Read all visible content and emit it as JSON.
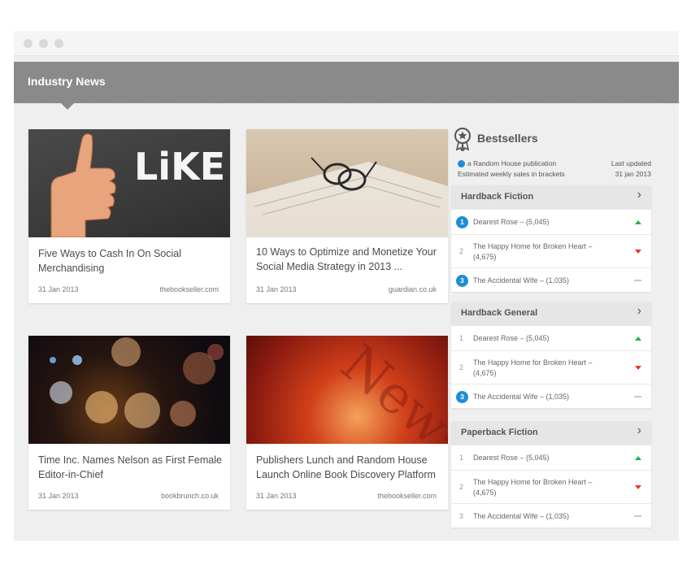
{
  "header": {
    "title": "Industry News"
  },
  "articles": [
    {
      "title": "Five Ways to Cash In On Social Merchandising",
      "date": "31 Jan 2013",
      "source": "thebookseller.com",
      "image_text": "LiKE THIS."
    },
    {
      "title": "10 Ways to Optimize and Monetize Your Social Media Strategy in 2013 ...",
      "date": "31 Jan 2013",
      "source": "guardian.co.uk"
    },
    {
      "title": "Time Inc. Names Nelson as First Female Editor-in-Chief",
      "date": "31 Jan 2013",
      "source": "bookbrunch.co.uk"
    },
    {
      "title": "Publishers Lunch and Random House Launch Online Book Discovery Platform",
      "date": "31 Jan 2013",
      "source": "thebookseller.com",
      "image_text": "News"
    }
  ],
  "bestsellers": {
    "title": "Bestsellers",
    "legend_line1": "a Random House publication",
    "legend_line2": "Estimated weekly sales in brackets",
    "updated_line1": "Last updated",
    "updated_line2": "31 jan 2013",
    "accent_color": "#1d8ed6",
    "sections": [
      {
        "title": "Hardback Fiction",
        "rows": [
          {
            "rank": "1",
            "text": "Dearest Rose  –  (5,045)",
            "random_house": true,
            "trend": "up"
          },
          {
            "rank": "2",
            "text": "The Happy Home for Broken Heart  –  (4,675)",
            "random_house": false,
            "trend": "down"
          },
          {
            "rank": "3",
            "text": "The Accidental Wife  –  (1,035)",
            "random_house": true,
            "trend": "flat"
          }
        ]
      },
      {
        "title": "Hardback General",
        "rows": [
          {
            "rank": "1",
            "text": "Dearest Rose  –  (5,045)",
            "random_house": false,
            "trend": "up"
          },
          {
            "rank": "2",
            "text": "The Happy Home for Broken Heart  –  (4,675)",
            "random_house": false,
            "trend": "down"
          },
          {
            "rank": "3",
            "text": "The Accidental Wife  –  (1,035)",
            "random_house": true,
            "trend": "flat"
          }
        ]
      },
      {
        "title": "Paperback  Fiction",
        "rows": [
          {
            "rank": "1",
            "text": "Dearest Rose  –  (5,045)",
            "random_house": false,
            "trend": "up"
          },
          {
            "rank": "2",
            "text": "The Happy Home for Broken Heart  –  (4,675)",
            "random_house": false,
            "trend": "down"
          },
          {
            "rank": "3",
            "text": "The Accidental Wife  –  (1,035)",
            "random_house": false,
            "trend": "flat"
          }
        ]
      }
    ]
  }
}
